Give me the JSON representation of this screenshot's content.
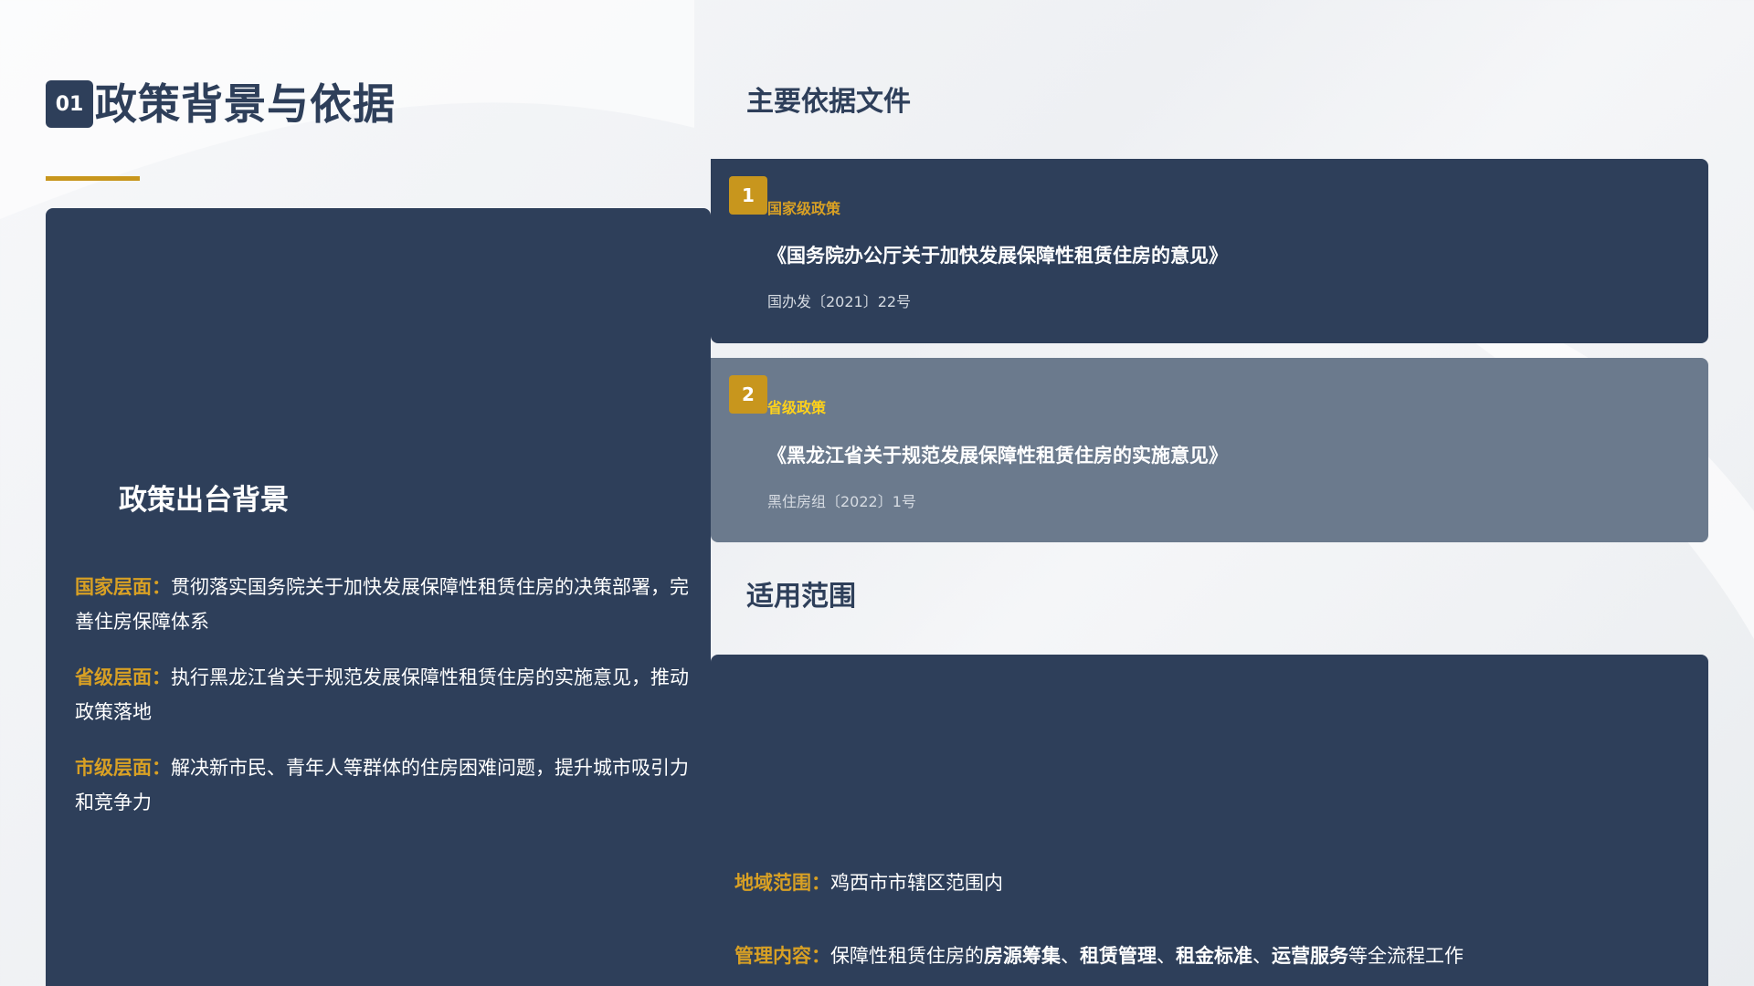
{
  "section": {
    "number": "01",
    "title": "政策背景与依据"
  },
  "background": {
    "heading": "政策出台背景",
    "items": [
      {
        "label": "国家层面：",
        "text": "贯彻落实国务院关于加快发展保障性租赁住房的决策部署，完善住房保障体系"
      },
      {
        "label": "省级层面：",
        "text": "执行黑龙江省关于规范发展保障性租赁住房的实施意见，推动政策落地"
      },
      {
        "label": "市级层面：",
        "text": "解决新市民、青年人等群体的住房困难问题，提升城市吸引力和竞争力"
      }
    ]
  },
  "documents": {
    "heading": "主要依据文件",
    "items": [
      {
        "index": "1",
        "level": "国家级政策",
        "name": "《国务院办公厅关于加快发展保障性租赁住房的意见》",
        "doc_no": "国办发〔2021〕22号"
      },
      {
        "index": "2",
        "level": "省级政策",
        "name": "《黑龙江省关于规范发展保障性租赁住房的实施意见》",
        "doc_no": "黑住房组〔2022〕1号"
      }
    ]
  },
  "scope": {
    "heading": "适用范围",
    "region_label": "地域范围：",
    "region_text": "鸡西市市辖区范围内",
    "mgmt_label": "管理内容：",
    "mgmt_prefix": "保障性租赁住房的",
    "mgmt_k1": "房源筹集",
    "sep1": "、",
    "mgmt_k2": "租赁管理",
    "sep2": "、",
    "mgmt_k3": "租金标准",
    "sep3": "、",
    "mgmt_k4": "运营服务",
    "mgmt_suffix": "等全流程工作"
  },
  "colors": {
    "navy": "#2e3f5a",
    "gold": "#c8961d",
    "slate": "#6b7a8d",
    "yellow": "#ffd21a"
  }
}
